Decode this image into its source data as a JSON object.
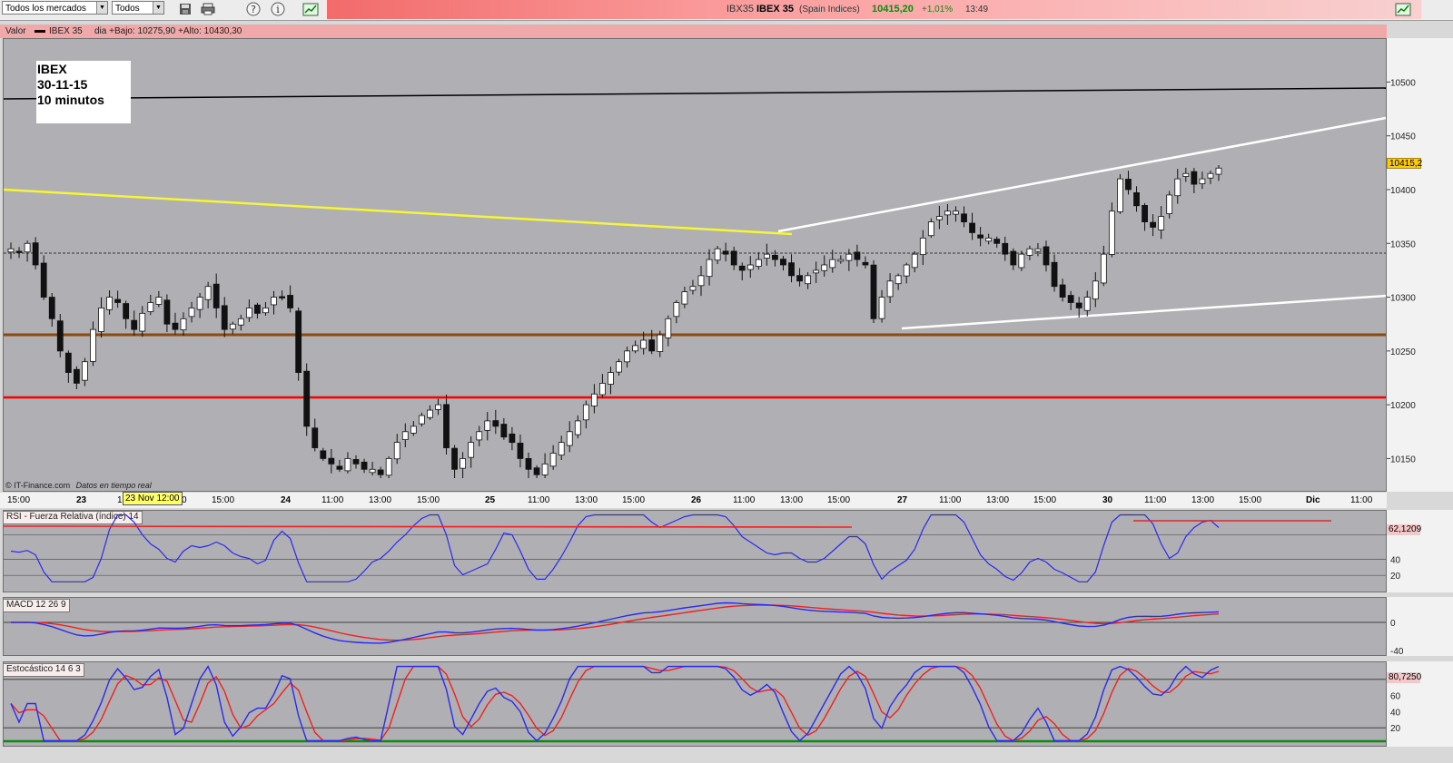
{
  "toolbar": {
    "market_select": "Todos los mercados",
    "filter_select": "Todos",
    "icons": [
      "save-icon",
      "print-icon",
      "help-icon",
      "info-icon",
      "chart-icon"
    ],
    "symbol": "IBX35",
    "name": "IBEX 35",
    "exchange": "(Spain Indices)",
    "price": "10415,20",
    "change": "+1,01%",
    "time": "13:49"
  },
  "info_bar": {
    "label": "Valor",
    "series": "IBEX 35",
    "range": "dia +Bajo: 10275,90 +Alto: 10430,30"
  },
  "annotation": {
    "line1": "IBEX",
    "line2": "30-11-15",
    "line3": "10 minutos"
  },
  "footer": {
    "copyright": "© IT-Finance.com",
    "realtime": "Datos en tiempo real"
  },
  "cursor_label": "23 Nov 12:00",
  "time_axis": [
    "15:00",
    "23",
    "1",
    "0",
    "15:00",
    "24",
    "11:00",
    "13:00",
    "15:00",
    "25",
    "11:00",
    "13:00",
    "15:00",
    "26",
    "11:00",
    "13:00",
    "15:00",
    "27",
    "11:00",
    "13:00",
    "15:00",
    "30",
    "11:00",
    "13:00",
    "15:00",
    "Dic",
    "11:00"
  ],
  "price_axis": [
    "10500",
    "10450",
    "10400",
    "10350",
    "10300",
    "10250",
    "10200",
    "10150"
  ],
  "price_tag": "10415,2",
  "rsi": {
    "label": "RSI - Fuerza Relativa (índice) 14",
    "axis": [
      "40",
      "20"
    ],
    "tag": "62,1209"
  },
  "macd": {
    "label": "MACD 12 26 9",
    "axis": [
      "0",
      "-40"
    ]
  },
  "stoch": {
    "label": "Estocástico 14 6 3",
    "axis": [
      "60",
      "40",
      "20"
    ],
    "tag": "80,7250"
  },
  "colors": {
    "panel": "#b0afb3",
    "yellow_line": "#f5f53a",
    "white_line": "#ffffff",
    "brown_line": "#8b4a10",
    "red_line": "#ff0000",
    "blue": "#2a2af0",
    "red": "#ee2222"
  },
  "chart_data": {
    "type": "candlestick",
    "title": "IBEX",
    "interval": "10 minutos",
    "ylim": [
      10120,
      10540
    ],
    "closes": [
      10345,
      10342,
      10350,
      10330,
      10300,
      10280,
      10250,
      10230,
      10220,
      10240,
      10270,
      10290,
      10300,
      10295,
      10280,
      10270,
      10285,
      10295,
      10300,
      10275,
      10270,
      10280,
      10290,
      10300,
      10310,
      10290,
      10270,
      10275,
      10280,
      10290,
      10285,
      10290,
      10300,
      10300,
      10290,
      10230,
      10180,
      10160,
      10150,
      10145,
      10140,
      10150,
      10145,
      10140,
      10140,
      10135,
      10150,
      10165,
      10175,
      10180,
      10190,
      10195,
      10200,
      10160,
      10140,
      10150,
      10165,
      10175,
      10185,
      10180,
      10170,
      10165,
      10150,
      10140,
      10135,
      10145,
      10155,
      10165,
      10175,
      10185,
      10200,
      10210,
      10220,
      10230,
      10240,
      10250,
      10255,
      10260,
      10250,
      10265,
      10280,
      10295,
      10305,
      10310,
      10320,
      10335,
      10345,
      10340,
      10330,
      10325,
      10330,
      10335,
      10340,
      10335,
      10330,
      10320,
      10315,
      10320,
      10325,
      10330,
      10335,
      10335,
      10340,
      10335,
      10330,
      10280,
      10300,
      10315,
      10320,
      10330,
      10340,
      10355,
      10370,
      10375,
      10380,
      10380,
      10370,
      10360,
      10355,
      10355,
      10350,
      10340,
      10330,
      10340,
      10345,
      10345,
      10330,
      10310,
      10300,
      10295,
      10290,
      10300,
      10315,
      10340,
      10380,
      10410,
      10400,
      10385,
      10370,
      10365,
      10375,
      10395,
      10410,
      10415,
      10405,
      10410,
      10415,
      10420
    ]
  }
}
